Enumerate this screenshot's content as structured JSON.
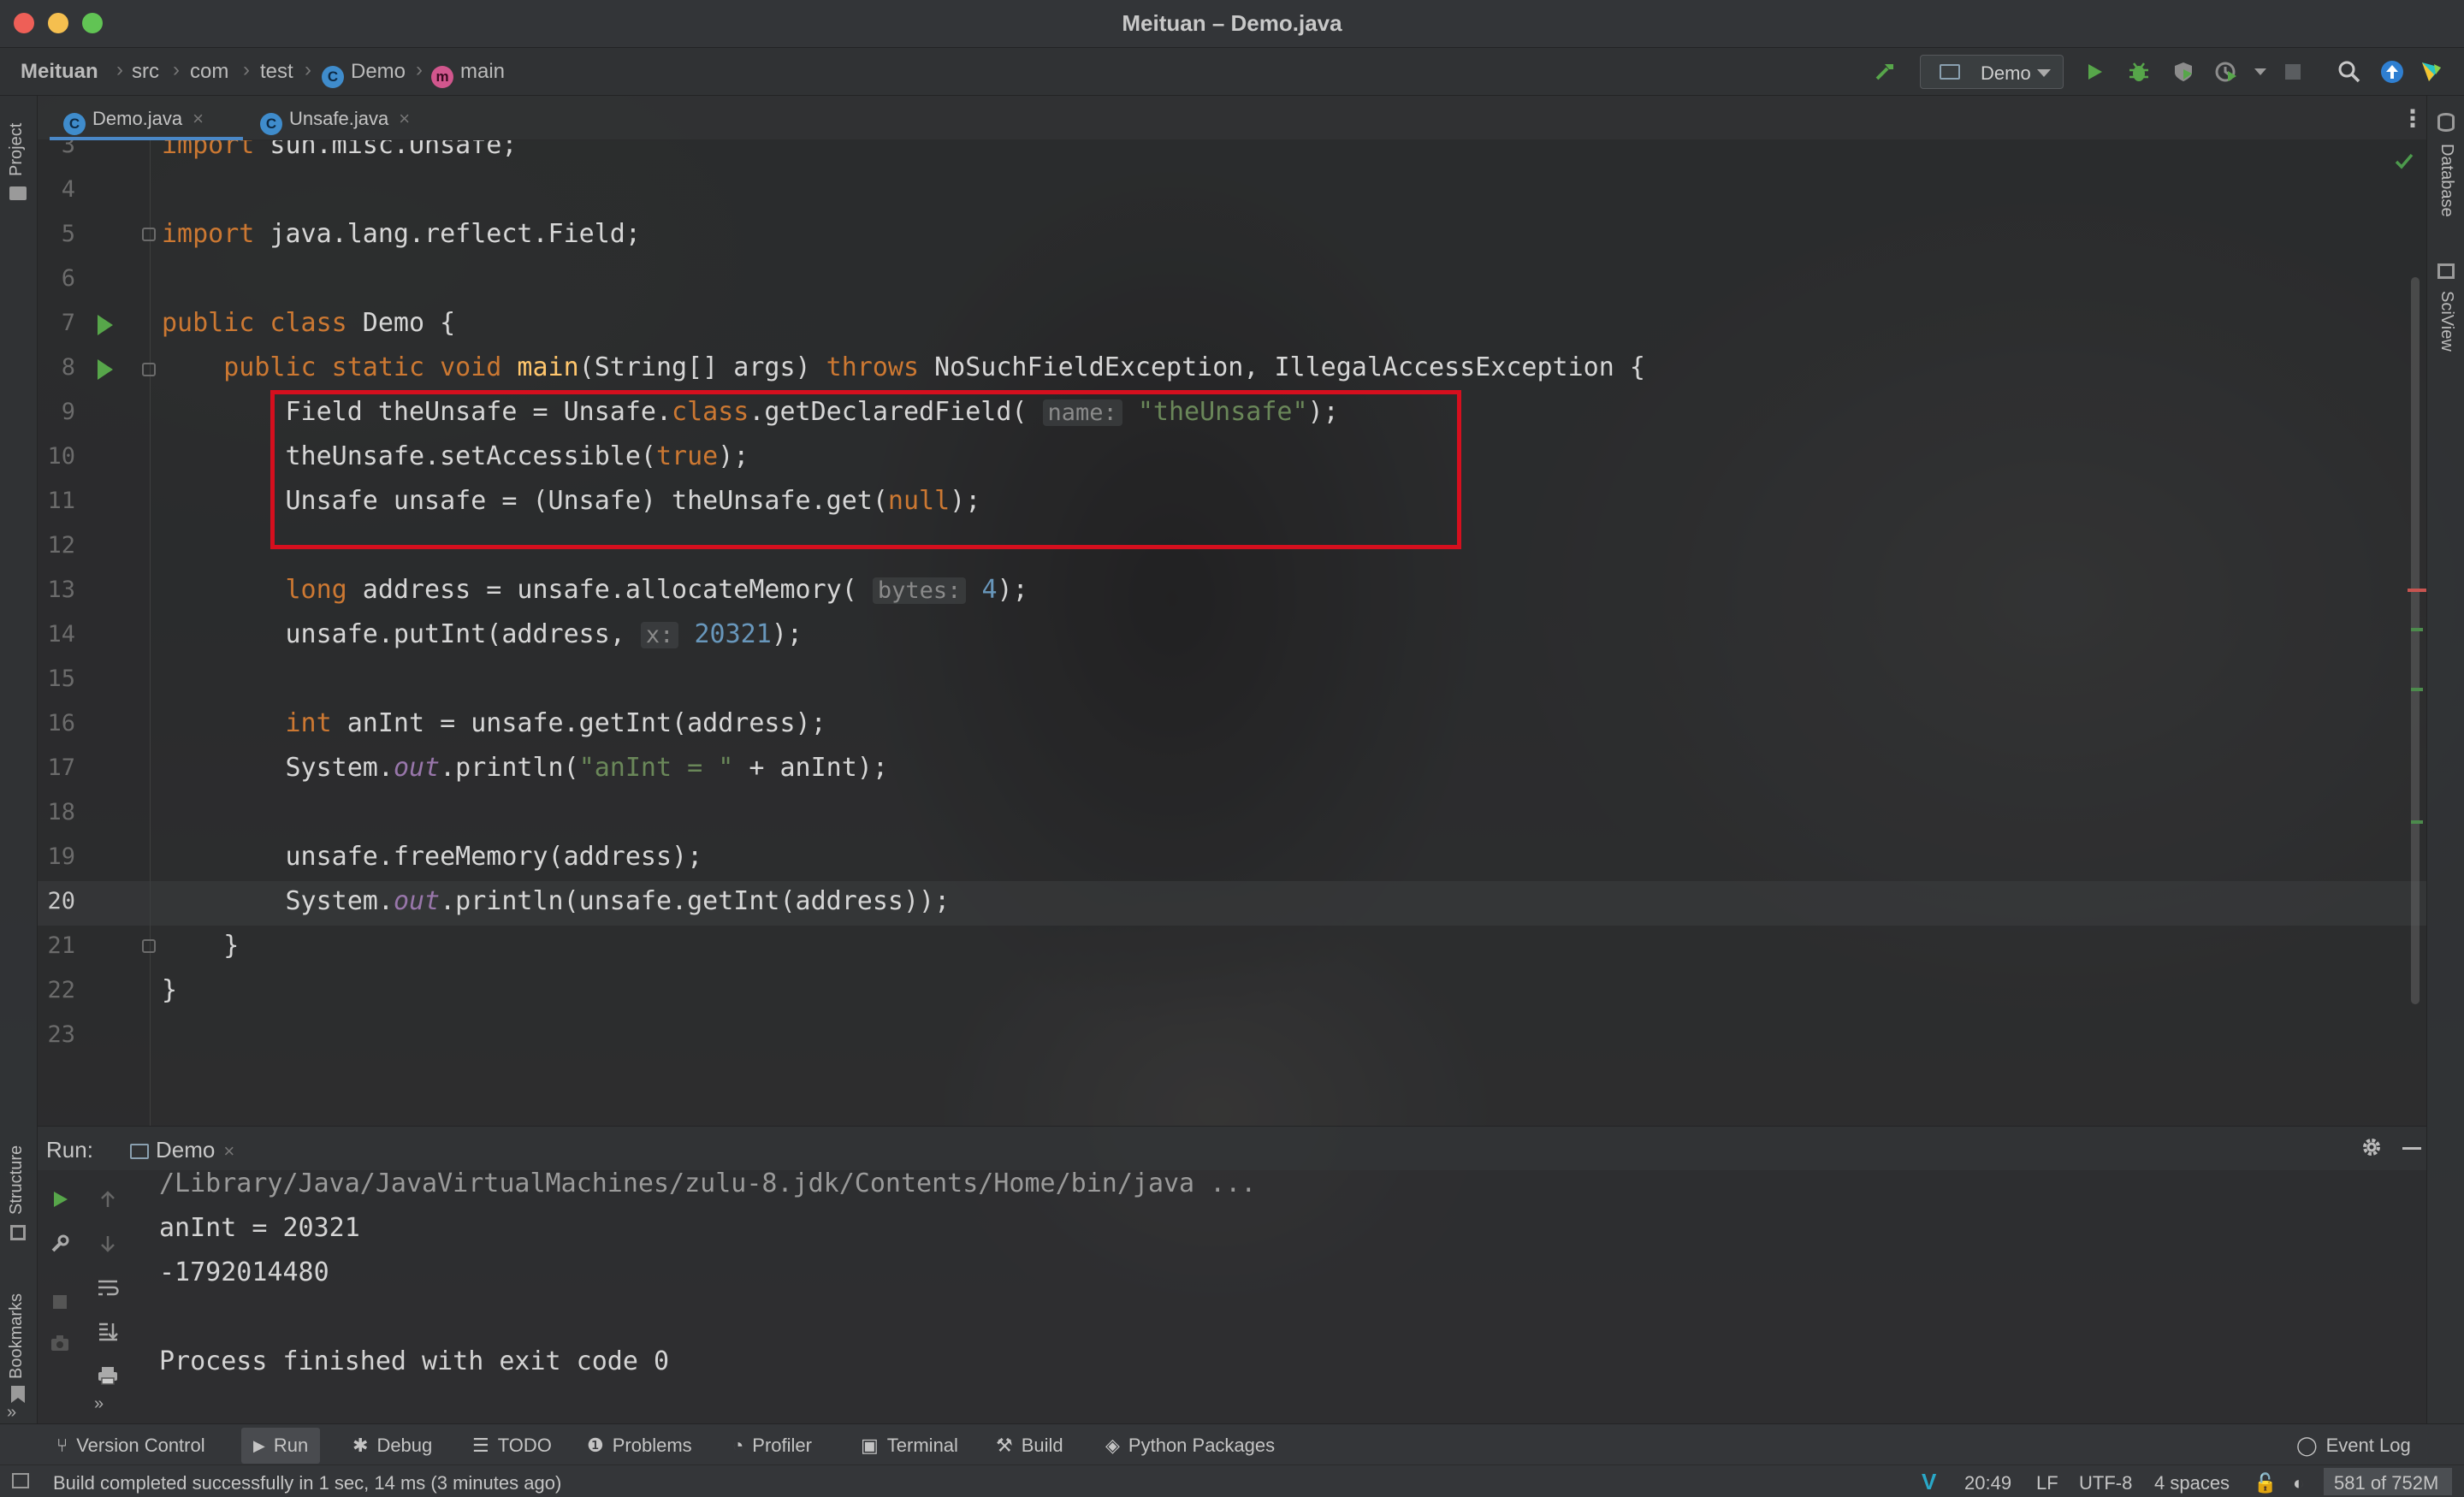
{
  "window": {
    "title": "Meituan – Demo.java"
  },
  "breadcrumb": {
    "project": "Meituan",
    "items": [
      "src",
      "com",
      "test"
    ],
    "class_badge": "C",
    "class_name": "Demo",
    "method_badge": "m",
    "method_name": "main"
  },
  "run_config": {
    "label": "Demo"
  },
  "side_panels": {
    "left_top": "Project",
    "left_mid": "Structure",
    "left_bottom": "Bookmarks",
    "right_top": "Database",
    "right_mid": "SciView"
  },
  "tabs": [
    {
      "label": "Demo.java",
      "badge": "C",
      "active": true
    },
    {
      "label": "Unsafe.java",
      "badge": "C",
      "active": false
    }
  ],
  "editor": {
    "lines": [
      {
        "n": "3"
      },
      {
        "n": "4"
      },
      {
        "n": "5"
      },
      {
        "n": "6"
      },
      {
        "n": "7"
      },
      {
        "n": "8"
      },
      {
        "n": "9"
      },
      {
        "n": "10"
      },
      {
        "n": "11"
      },
      {
        "n": "12"
      },
      {
        "n": "13"
      },
      {
        "n": "14"
      },
      {
        "n": "15"
      },
      {
        "n": "16"
      },
      {
        "n": "17"
      },
      {
        "n": "18"
      },
      {
        "n": "19"
      },
      {
        "n": "20"
      },
      {
        "n": "21"
      },
      {
        "n": "22"
      },
      {
        "n": "23"
      }
    ],
    "tokens": {
      "l3_kw": "import",
      "l3_rest": " sun.misc.Unsafe;",
      "l5_kw": "import",
      "l5_rest": " java.lang.reflect.Field;",
      "l7_kw": "public class",
      "l7_rest": " Demo {",
      "l8_kw1": "public static void",
      "l8_fn": "main",
      "l8_mid": "(String[] args) ",
      "l8_kw2": "throws",
      "l8_rest": " NoSuchFieldException, IllegalAccessException {",
      "l9_a": "Field theUnsafe = Unsafe.",
      "l9_kw": "class",
      "l9_b": ".getDeclaredField(",
      "l9_hint": "name:",
      "l9_str": "\"theUnsafe\"",
      "l9_c": ");",
      "l10_a": "theUnsafe.setAccessible(",
      "l10_kw": "true",
      "l10_b": ");",
      "l11_a": "Unsafe unsafe = (Unsafe) theUnsafe.get(",
      "l11_kw": "null",
      "l11_b": ");",
      "l13_kw": "long",
      "l13_a": " address = unsafe.allocateMemory(",
      "l13_hint": "bytes:",
      "l13_num": "4",
      "l13_b": ");",
      "l14_a": "unsafe.putInt(address,",
      "l14_hint": "x:",
      "l14_num": "20321",
      "l14_b": ");",
      "l16_kw": "int",
      "l16_a": " anInt = unsafe.getInt(address);",
      "l17_a": "System.",
      "l17_fld": "out",
      "l17_b": ".println(",
      "l17_str": "\"anInt = \"",
      "l17_c": " + anInt);",
      "l19_a": "unsafe.freeMemory(address);",
      "l20_a": "System.",
      "l20_fld": "out",
      "l20_b": ".println(unsafe.getInt(address));",
      "l21_a": "}",
      "l22_a": "}"
    }
  },
  "run_panel": {
    "label": "Run:",
    "tab": "Demo",
    "console": [
      "/Library/Java/JavaVirtualMachines/zulu-8.jdk/Contents/Home/bin/java ...",
      "anInt = 20321",
      "-1792014480",
      "",
      "Process finished with exit code 0"
    ]
  },
  "tool_windows": {
    "version_control": "Version Control",
    "run": "Run",
    "debug": "Debug",
    "todo": "TODO",
    "problems": "Problems",
    "profiler": "Profiler",
    "terminal": "Terminal",
    "build": "Build",
    "python_packages": "Python Packages",
    "event_log": "Event Log"
  },
  "status": {
    "message": "Build completed successfully in 1 sec, 14 ms (3 minutes ago)",
    "position": "20:49",
    "line_sep": "LF",
    "encoding": "UTF-8",
    "indent": "4 spaces",
    "memory": "581 of 752M"
  },
  "colors": {
    "accent": "#4a88c7",
    "highlight_box": "#d50f1e",
    "run_green": "#57a64a"
  }
}
